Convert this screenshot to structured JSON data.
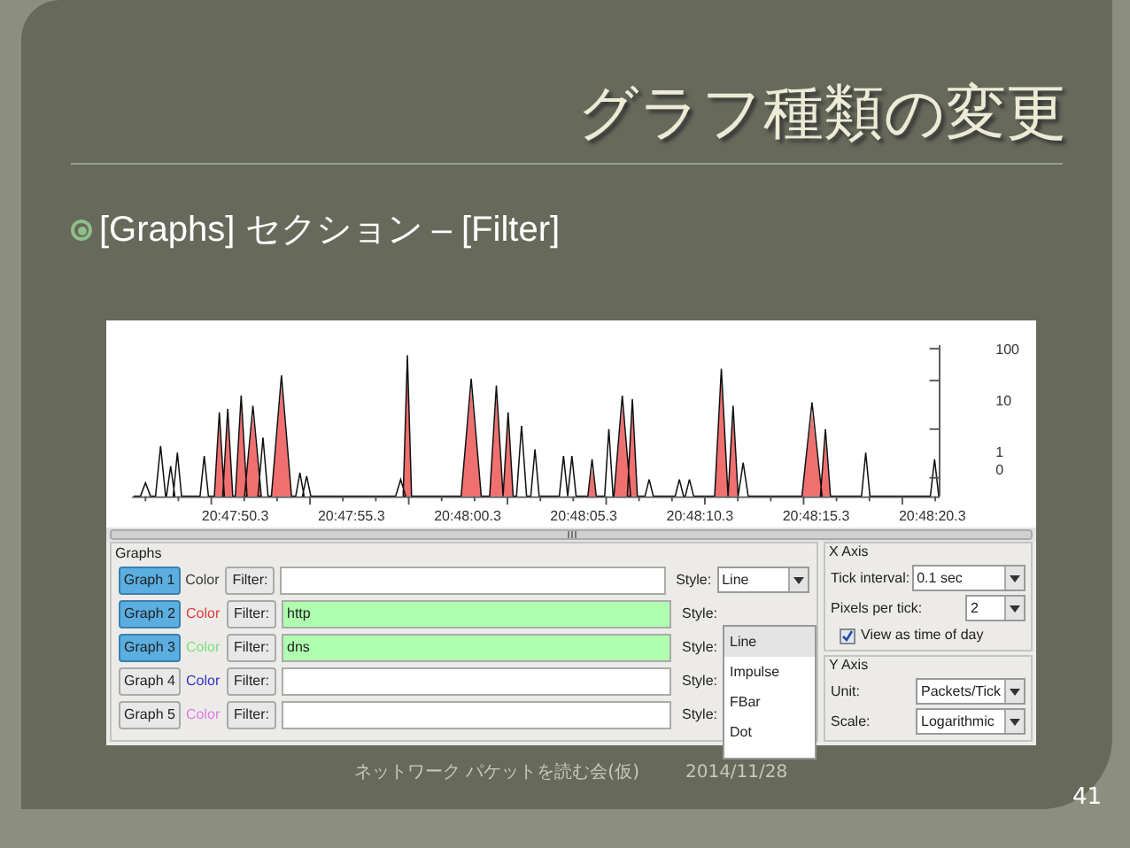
{
  "slide": {
    "title": "グラフ種類の変更",
    "bullet": "[Graphs] セクション – [Filter]",
    "footer": "ネットワーク パケットを読む会(仮)",
    "date": "2014/11/28",
    "page": "41"
  },
  "graph": {
    "x_labels": [
      "20:47:50.3",
      "20:47:55.3",
      "20:48:00.3",
      "20:48:05.3",
      "20:48:10.3",
      "20:48:15.3",
      "20:48:20.3"
    ],
    "y_labels": [
      "100",
      "10",
      "1",
      "0"
    ]
  },
  "graphs_group": {
    "title": "Graphs",
    "rows": [
      {
        "button": "Graph 1",
        "selected": true,
        "color_label": "Color",
        "color": "#3a3a3a",
        "filter_button": "Filter:",
        "valid": false,
        "style_label": "Style:",
        "style": "Line"
      },
      {
        "button": "Graph 2",
        "selected": true,
        "color_label": "Color",
        "color": "#e03c3c",
        "filter_button": "Filter:",
        "filter": "http",
        "valid": true,
        "style_label": "Style:"
      },
      {
        "button": "Graph 3",
        "selected": true,
        "color_label": "Color",
        "color": "#7fe07f",
        "filter_button": "Filter:",
        "filter": "dns",
        "valid": true,
        "style_label": "Style:"
      },
      {
        "button": "Graph 4",
        "selected": false,
        "color_label": "Color",
        "color": "#3434c0",
        "filter_button": "Filter:",
        "valid": false,
        "style_label": "Style:"
      },
      {
        "button": "Graph 5",
        "selected": false,
        "color_label": "Color",
        "color": "#e47ae4",
        "filter_button": "Filter:",
        "valid": false,
        "style_label": "Style:"
      }
    ],
    "dropdown": [
      {
        "label": "Line",
        "selected": true
      },
      {
        "label": "Impulse",
        "selected": false
      },
      {
        "label": "FBar",
        "selected": false
      },
      {
        "label": "Dot",
        "selected": false
      }
    ]
  },
  "x_axis": {
    "title": "X Axis",
    "tick_interval_label": "Tick interval:",
    "tick_interval": "0.1 sec",
    "pixels_label": "Pixels per tick:",
    "pixels": "2",
    "time_of_day": {
      "label": "View as time of day",
      "checked": true
    }
  },
  "y_axis": {
    "title": "Y Axis",
    "unit_label": "Unit:",
    "unit": "Packets/Tick",
    "scale_label": "Scale:",
    "scale": "Logarithmic"
  }
}
